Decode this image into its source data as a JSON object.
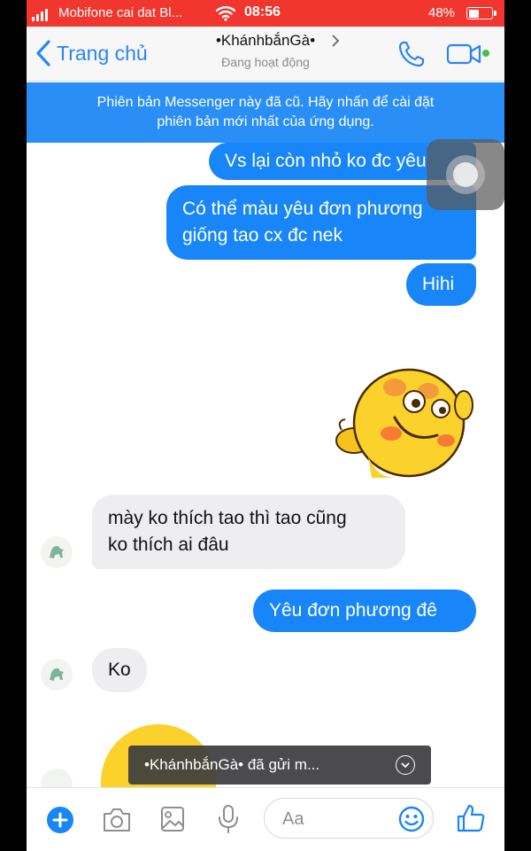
{
  "status_bar": {
    "carrier": "Mobifone cai dat Bl...",
    "time": "08:56",
    "battery_percent": "48%",
    "battery_level": 0.48
  },
  "nav": {
    "back_label": "Trang chủ",
    "contact_name": "•KhánhbắnGà•",
    "status": "Đang hoạt động",
    "icons": [
      "chevron-left-icon",
      "chevron-right-icon",
      "phone-icon",
      "video-icon",
      "active-dot"
    ]
  },
  "banner": {
    "line1": "Phiên bản Messenger này đã cũ. Hãy nhấn để cài đặt",
    "line2": "phiên bản mới nhất của ứng dụng."
  },
  "messages": [
    {
      "side": "out",
      "lines": [
        "Vs lại còn nhỏ ko đc yêu"
      ]
    },
    {
      "side": "out",
      "lines": [
        "Có thể màu yêu đơn phương",
        "giống tao cx đc nek"
      ]
    },
    {
      "side": "out",
      "lines": [
        "Hihi"
      ]
    },
    {
      "side": "out",
      "type": "sticker",
      "icon": "sticker-icon"
    },
    {
      "side": "in",
      "lines": [
        "mày ko thích tao thì tao cũng",
        "ko thích ai đâu"
      ]
    },
    {
      "side": "out",
      "lines": [
        "Yêu đơn phương đê"
      ]
    },
    {
      "side": "in",
      "lines": [
        "Ko"
      ]
    }
  ],
  "toast": {
    "text": "•KhánhbắnGà• đã gửi m..."
  },
  "composer": {
    "placeholder": "Aa",
    "icons": [
      "plus-icon",
      "camera-icon",
      "image-icon",
      "microphone-icon",
      "emoji-icon",
      "thumbs-up-icon"
    ]
  },
  "colors": {
    "status_bar": "#f0362e",
    "accent": "#2a85f5",
    "outgoing_bubble": "#1886f8",
    "incoming_bubble": "#eeeef0",
    "banner": "#2a8ef7",
    "active": "#3fc24b"
  }
}
